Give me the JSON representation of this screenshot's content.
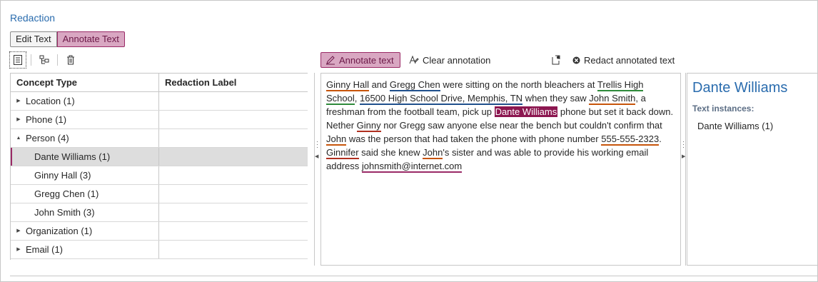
{
  "app": {
    "title": "Redaction"
  },
  "mode_toggle": {
    "edit_label": "Edit Text",
    "annotate_label": "Annotate Text",
    "active": "Annotate Text"
  },
  "left_toolbar": {
    "icons": [
      "document-list-icon",
      "hierarchy-icon",
      "trash-icon"
    ]
  },
  "table": {
    "headers": {
      "concept_type": "Concept Type",
      "redaction_label": "Redaction Label"
    },
    "rows": [
      {
        "label": "Location (1)",
        "expanded": false,
        "level": 0
      },
      {
        "label": "Phone (1)",
        "expanded": false,
        "level": 0
      },
      {
        "label": "Person (4)",
        "expanded": true,
        "level": 0
      },
      {
        "label": "Dante Williams (1)",
        "level": 1,
        "selected": true
      },
      {
        "label": "Ginny Hall (3)",
        "level": 1
      },
      {
        "label": "Gregg Chen (1)",
        "level": 1
      },
      {
        "label": "John Smith (3)",
        "level": 1
      },
      {
        "label": "Organization (1)",
        "expanded": false,
        "level": 0
      },
      {
        "label": "Email (1)",
        "expanded": false,
        "level": 0
      }
    ]
  },
  "doc_toolbar": {
    "annotate_label": "Annotate text",
    "clear_label": "Clear annotation",
    "redact_label": "Redact annotated text"
  },
  "document": {
    "t1": "Ginny Hall",
    "t2": " and ",
    "t3": "Gregg Chen",
    "t4": " were sitting on the north bleachers at ",
    "t5": "Trellis High School",
    "t6": ", ",
    "t7": "16500 High School Drive, Memphis, TN",
    "t8": " when they saw ",
    "t9": "John Smith",
    "t10": ", a freshman from the football team, pick up ",
    "t11": "Dante Williams",
    "t12": " phone but set it back down. Nether ",
    "t13": "Ginny",
    "t14": " nor Gregg saw anyone else near the bench but couldn't confirm that ",
    "t15": "John",
    "t16": " was the person that had taken the phone with phone number ",
    "t17": "555-555-2323",
    "t18": ". ",
    "t19": "Ginnifer",
    "t20": " said she knew ",
    "t21": "John",
    "t22": "'s sister and was able to provide his working email address ",
    "t23": "johnsmith@internet.com"
  },
  "detail": {
    "name": "Dante Williams",
    "instances_label": "Text instances:",
    "instances": [
      "Dante Williams (1)"
    ]
  },
  "colors": {
    "accent": "#9a2a66",
    "highlight": "#8c1750",
    "title_blue": "#2a6cae"
  }
}
